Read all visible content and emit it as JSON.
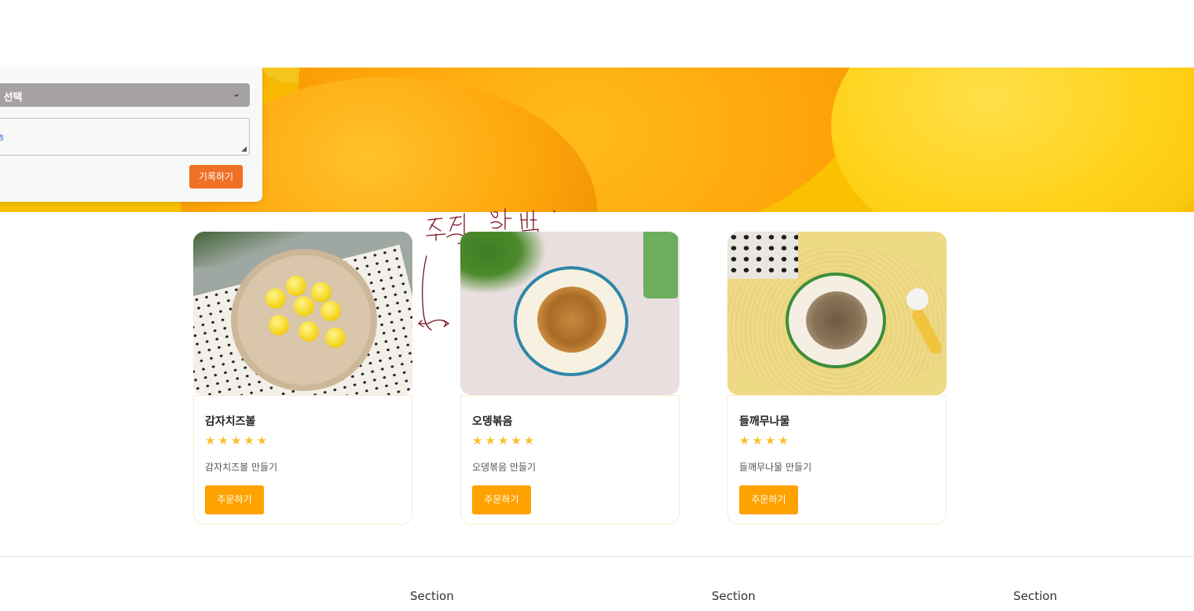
{
  "feedback_form": {
    "select_value": "점 선택",
    "textarea_value": "ㅎ",
    "submit_label": "기록하기"
  },
  "annotation": {
    "handwritten_text": "줄이는 방법."
  },
  "products": [
    {
      "name": "감자치즈볼",
      "rating": 5,
      "stars": "★★★★★",
      "description": "감자치즈볼 만들기",
      "order_label": "주문하기"
    },
    {
      "name": "오뎅볶음",
      "rating": 5,
      "stars": "★★★★★",
      "description": "오뎅볶음 만들기",
      "order_label": "주문하기"
    },
    {
      "name": "들깨무나물",
      "rating": 4,
      "stars": "★★★★",
      "description": "들깨무나물 만들기",
      "order_label": "주문하기"
    }
  ],
  "footer": {
    "sections": [
      "Section",
      "Section",
      "Section"
    ]
  },
  "colors": {
    "accent_order": "#ffa200",
    "submit_button": "#f07026",
    "star": "#f6c12b"
  }
}
